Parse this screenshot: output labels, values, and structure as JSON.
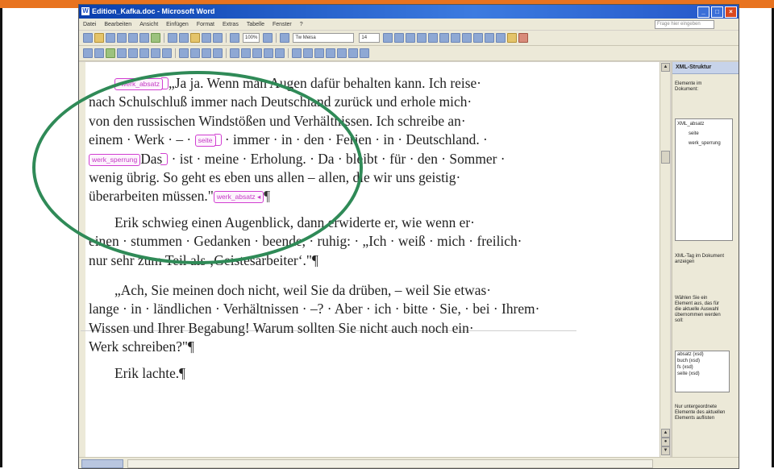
{
  "window": {
    "title": "Edition_Kafka.doc - Microsoft Word",
    "icon": "word-doc-icon"
  },
  "menubar": {
    "items": [
      "Datei",
      "Bearbeiten",
      "Ansicht",
      "Einfügen",
      "Format",
      "Extras",
      "Tabelle",
      "Fenster",
      "?"
    ],
    "help_placeholder": "Frage hier eingeben"
  },
  "toolbar": {
    "zoom": "100%",
    "font_name": "Tw Meisa",
    "font_size": "14"
  },
  "document": {
    "paragraphs": [
      {
        "lines": [
          {
            "tag_start": "werk_absatz",
            "text": "„Ja ja. Wenn man Augen dafür behalten kann. Ich reise·"
          },
          {
            "text": "nach Schulschluß immer nach Deutschland zurück und erhole mich·"
          },
          {
            "text": "von den russischen Windstößen und Verhältnissen. Ich schreibe an·"
          },
          {
            "text_before": "einem · Werk · – · ",
            "tag_inline": "seite",
            "text_after": " · immer · in · den · Ferien · in · Deutschland. ·"
          },
          {
            "tag_start": "werk_sperrung",
            "text_before": "Das",
            "text_after": " · ist · meine · Erholung. · Da · bleibt · für · den · Sommer ·"
          },
          {
            "text": "wenig übrig. So geht es eben uns allen – allen, die wir uns geistig·"
          },
          {
            "text": "überarbeiten müssen.\"",
            "tag_end": "werk_absatz",
            "pilcrow": "¶"
          }
        ]
      },
      {
        "lines": [
          {
            "text": "Erik schwieg einen Augenblick, dann erwiderte er, wie wenn er·"
          },
          {
            "text": "einen · stummen · Gedanken · beende, · ruhig: · „Ich · weiß · mich · freilich·"
          },
          {
            "text": "nur sehr zum Teil als ‚Geistesarbeiter‘.\"¶"
          }
        ]
      },
      {
        "lines": [
          {
            "text": "„Ach, Sie meinen doch nicht, weil Sie da drüben, – weil Sie etwas·"
          },
          {
            "text": "lange · in · ländlichen · Verhältnissen · –? · Aber · ich · bitte · Sie, · bei · Ihrem·"
          },
          {
            "text": "Wissen und Ihrer Begabung! Warum sollten Sie nicht auch noch ein·"
          },
          {
            "text": "Werk schreiben?\"¶"
          }
        ]
      },
      {
        "lines": [
          {
            "text": "Erik lachte.¶"
          }
        ]
      }
    ]
  },
  "taskpane": {
    "title": "XML-Struktur",
    "section_label": "Elemente im Dokument:",
    "tree_items": [
      "XML_absatz",
      "seite",
      "werk_sperrung"
    ],
    "checkbox_label": "XML-Tag im Dokument anzeigen",
    "help_text": "Wählen Sie ein Element aus, das für die aktuelle Auswahl übernommen werden soll:",
    "list_items": [
      "absatz (xsd)",
      "buch (xsd)",
      "fs (xsd)",
      "seite (xsd)"
    ],
    "bottom_checkbox_label": "Nur untergeordnete Elemente des aktuellen Elements auflisten"
  },
  "colors": {
    "xml_tag": "#d13fd1",
    "highlight_circle": "#2f8a57",
    "outer_bar": "#e8731f"
  }
}
